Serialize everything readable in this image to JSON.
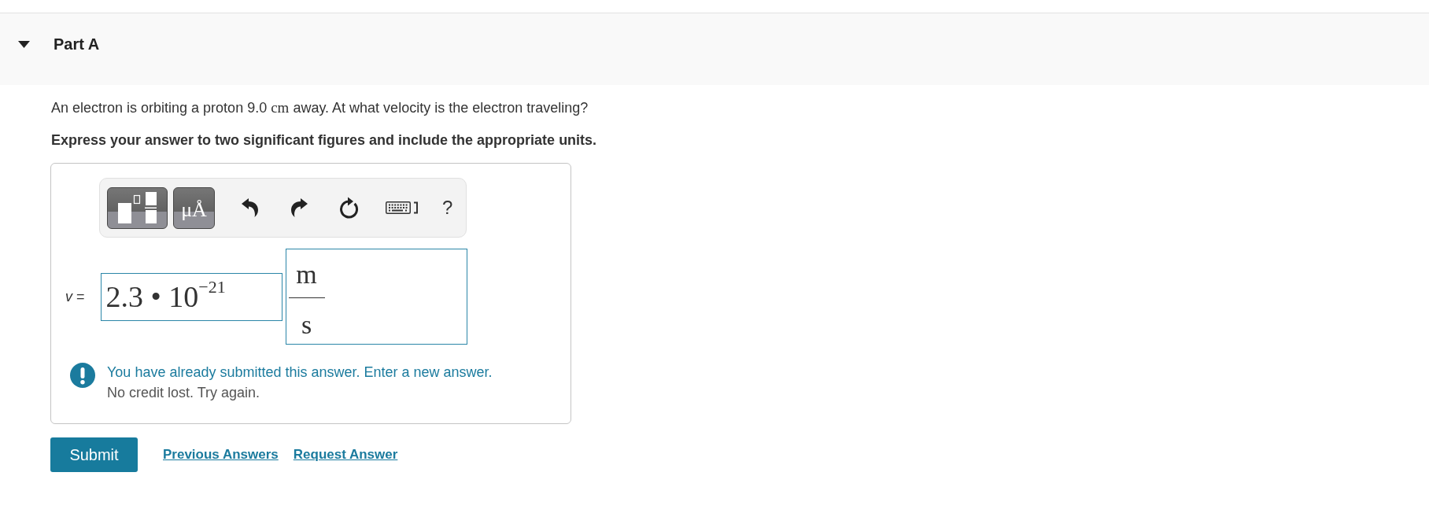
{
  "part": {
    "title": "Part A",
    "expanded": true
  },
  "question": {
    "segments": [
      {
        "kind": "text",
        "text": "An electron is orbiting a proton 9.0 "
      },
      {
        "kind": "math",
        "text": "cm"
      },
      {
        "kind": "text",
        "text": " away. At what velocity is the electron traveling?"
      }
    ]
  },
  "instructions": "Express your answer to two significant figures and include the appropriate units.",
  "answer": {
    "toolbar": [
      {
        "kind": "templates"
      },
      {
        "kind": "units",
        "label": "μÅ"
      },
      {
        "kind": "undo"
      },
      {
        "kind": "redo"
      },
      {
        "kind": "reset"
      },
      {
        "kind": "keyboard"
      },
      {
        "kind": "help",
        "label": "?"
      }
    ],
    "label": "*v* =",
    "value": "2.3 • 10$^{−21}$",
    "unit": {
      "numerator": "m",
      "denominator": "s"
    }
  },
  "feedback": {
    "message": "You have already submitted this answer. Enter a new answer.",
    "note": "No credit lost. Try again."
  },
  "actions": {
    "submit": "Submit",
    "links": [
      "Previous Answers",
      "Request Answer"
    ]
  }
}
